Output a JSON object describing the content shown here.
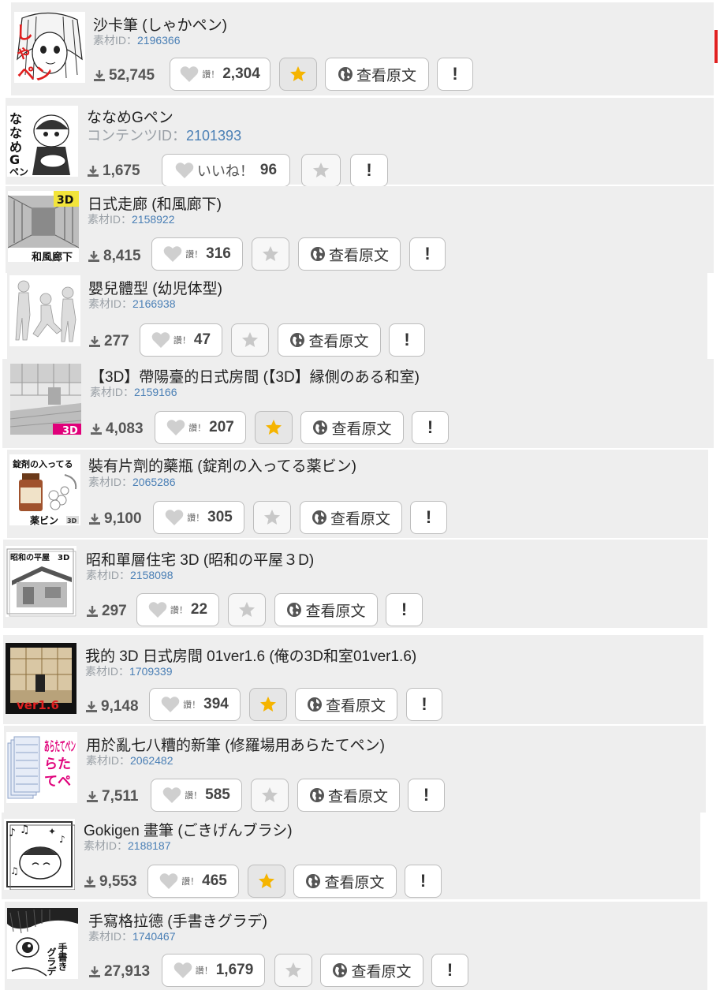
{
  "strings": {
    "id_label": "素材ID：",
    "like_label": "讚！",
    "view_original": "查看原文",
    "report": "!"
  },
  "items": [
    {
      "title": "沙卡筆 (しゃかペン)",
      "id_label": "素材ID：",
      "id": "2196366",
      "downloads": "52,745",
      "like_label": "讚！",
      "likes": "2,304",
      "favorited": true,
      "view_original": "查看原文",
      "thumb_text": "しゃかペン"
    },
    {
      "title": "ななめGペン",
      "id_label": "コンテンツID：",
      "id": "2101393",
      "downloads": "1,675",
      "like_label": "いいね！",
      "likes": "96",
      "favorited": false,
      "thumb_text": "ななめGペン"
    },
    {
      "title": "日式走廊 (和風廊下)",
      "id_label": "素材ID：",
      "id": "2158922",
      "downloads": "8,415",
      "like_label": "讚！",
      "likes": "316",
      "favorited": false,
      "view_original": "查看原文",
      "thumb_text": "和風廊下",
      "thumb_badge": "3D"
    },
    {
      "title": "嬰兒體型 (幼児体型)",
      "id_label": "素材ID：",
      "id": "2166938",
      "downloads": "277",
      "like_label": "讚！",
      "likes": "47",
      "favorited": false,
      "view_original": "查看原文"
    },
    {
      "title": "【3D】帶陽臺的日式房間 (【3D】縁側のある和室)",
      "id_label": "素材ID：",
      "id": "2159166",
      "downloads": "4,083",
      "like_label": "讚！",
      "likes": "207",
      "favorited": true,
      "view_original": "查看原文",
      "thumb_badge": "3D"
    },
    {
      "title": "裝有片劑的藥瓶 (錠剤の入ってる薬ビン)",
      "id_label": "素材ID：",
      "id": "2065286",
      "downloads": "9,100",
      "like_label": "讚！",
      "likes": "305",
      "favorited": false,
      "view_original": "查看原文",
      "thumb_text": "錠剤の入ってる",
      "thumb_text2": "薬ビン",
      "thumb_badge": "3D"
    },
    {
      "title": "昭和單層住宅 3D (昭和の平屋３D)",
      "id_label": "素材ID：",
      "id": "2158098",
      "downloads": "297",
      "like_label": "讚！",
      "likes": "22",
      "favorited": false,
      "view_original": "查看原文",
      "thumb_text": "昭和の平屋",
      "thumb_badge": "3D"
    },
    {
      "title": "我的 3D 日式房間 01ver1.6 (俺の3D和室01ver1.6)",
      "id_label": "素材ID：",
      "id": "1709339",
      "downloads": "9,148",
      "like_label": "讚！",
      "likes": "394",
      "favorited": true,
      "view_original": "查看原文",
      "thumb_text": "ver1.6"
    },
    {
      "title": "用於亂七八糟的新筆 (修羅場用あらたてペン)",
      "id_label": "素材ID：",
      "id": "2062482",
      "downloads": "7,511",
      "like_label": "讚！",
      "likes": "585",
      "favorited": false,
      "view_original": "查看原文",
      "thumb_text": "あらたてペン"
    },
    {
      "title": "Gokigen 畫筆 (ごきげんブラシ)",
      "id_label": "素材ID：",
      "id": "2188187",
      "downloads": "9,553",
      "like_label": "讚！",
      "likes": "465",
      "favorited": true,
      "view_original": "查看原文"
    },
    {
      "title": "手寫格拉德 (手書きグラデ)",
      "id_label": "素材ID：",
      "id": "1740467",
      "downloads": "27,913",
      "like_label": "讚！",
      "likes": "1,679",
      "favorited": false,
      "view_original": "查看原文",
      "thumb_text": "手書き",
      "thumb_text2": "グラデ"
    }
  ],
  "colors": {
    "star_on": "#f5b400",
    "star_off": "#c8c8c8",
    "heart": "#cfcfcf",
    "id_link": "#4a7fb5",
    "row_bg": "#eeeeee"
  }
}
